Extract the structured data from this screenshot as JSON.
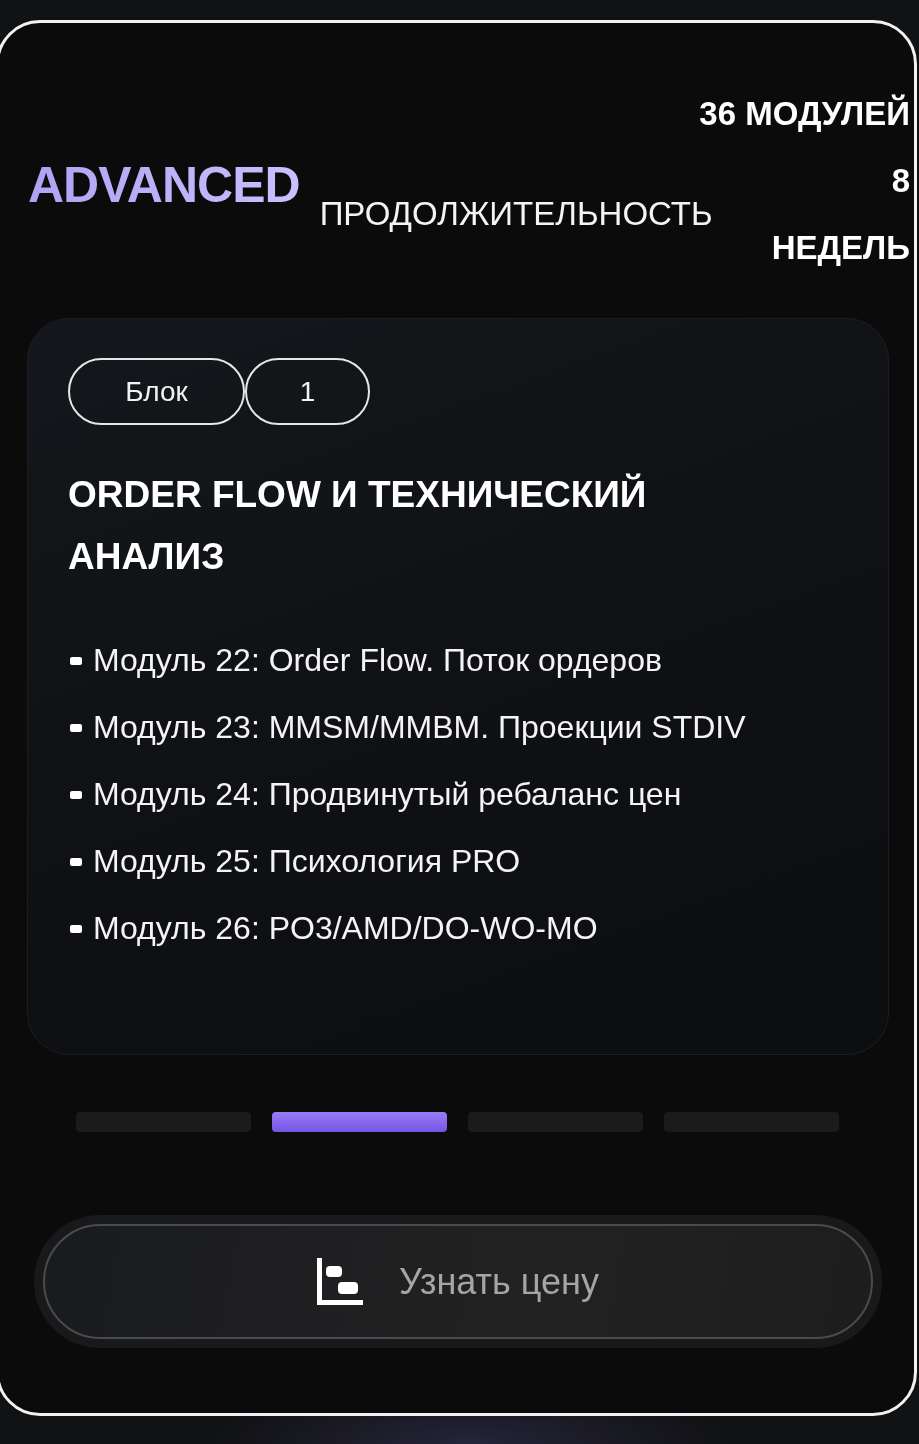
{
  "header": {
    "level_name": "ADVANCED",
    "modules_count": "36 МОДУЛЕЙ",
    "duration_label": "ПРОДОЛЖИТЕЛЬНОСТЬ",
    "duration_value": "8",
    "duration_unit": "НЕДЕЛЬ"
  },
  "block_card": {
    "block_label": "Блок",
    "block_number": "1",
    "title": "ORDER FLOW И ТЕХНИЧЕСКИЙ АНАЛИЗ",
    "modules": [
      "Модуль 22: Order Flow. Поток ордеров",
      "Модуль 23: MMSM/MMBM. Проекции STDIV",
      "Модуль 24: Продвинутый ребаланс цен",
      "Модуль 25: Психология PRO",
      "Модуль 26: PO3/AMD/DO-WO-MO"
    ]
  },
  "pagination": [
    {
      "selected": false
    },
    {
      "selected": true
    },
    {
      "selected": false
    },
    {
      "selected": false
    }
  ],
  "price_button": {
    "label": "Узнать цену"
  }
}
